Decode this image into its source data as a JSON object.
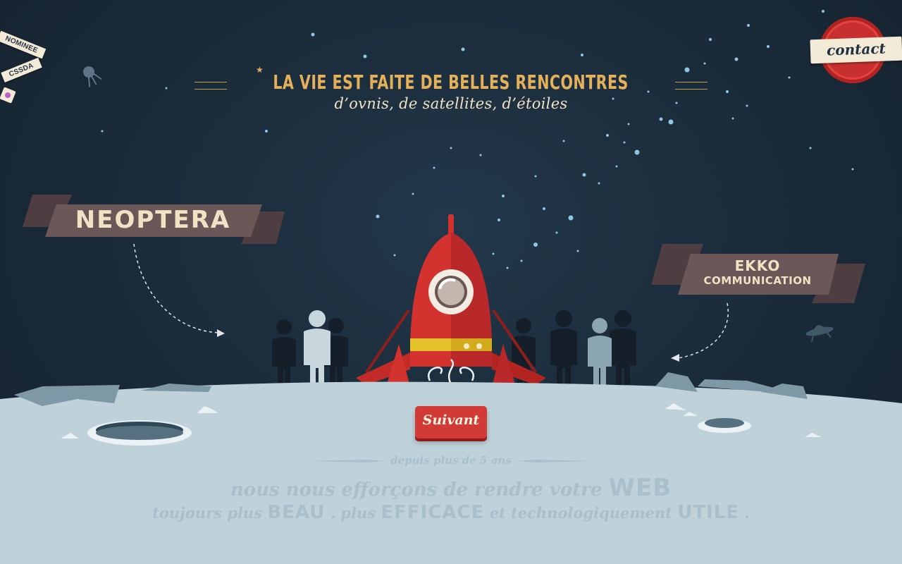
{
  "nominee": {
    "line1": "NOMINEE",
    "line2": "CSSDA"
  },
  "contact": {
    "label": "contact"
  },
  "headline": {
    "title": "LA VIE EST FAITE DE BELLES RENCONTRES",
    "subtitle": "d’ovnis, de satellites, d’étoiles"
  },
  "banners": {
    "left": {
      "label": "NEOPTERA"
    },
    "right": {
      "line1": "EKKO",
      "line2": "COMMUNICATION"
    }
  },
  "cta": {
    "label": "Suivant"
  },
  "tagline": {
    "line1": "depuis plus de 5 ans",
    "line2_text": "nous nous efforçons de rendre votre",
    "line2_cap": "WEB",
    "line3_a": "toujours plus",
    "line3_cap1": "BEAU",
    "line3_b": ".  plus",
    "line3_cap2": "EFFICACE",
    "line3_c": " et technologiquement",
    "line3_cap3": "UTILE",
    "line3_d": "."
  },
  "colors": {
    "sky": "#1b2c3b",
    "ground": "#bfd2da",
    "accent_red": "#d13a35",
    "gold": "#e4b05a",
    "banner": "#6b5658"
  },
  "icons": [
    "satellite-icon",
    "ufo-icon",
    "rocket-illustration"
  ]
}
